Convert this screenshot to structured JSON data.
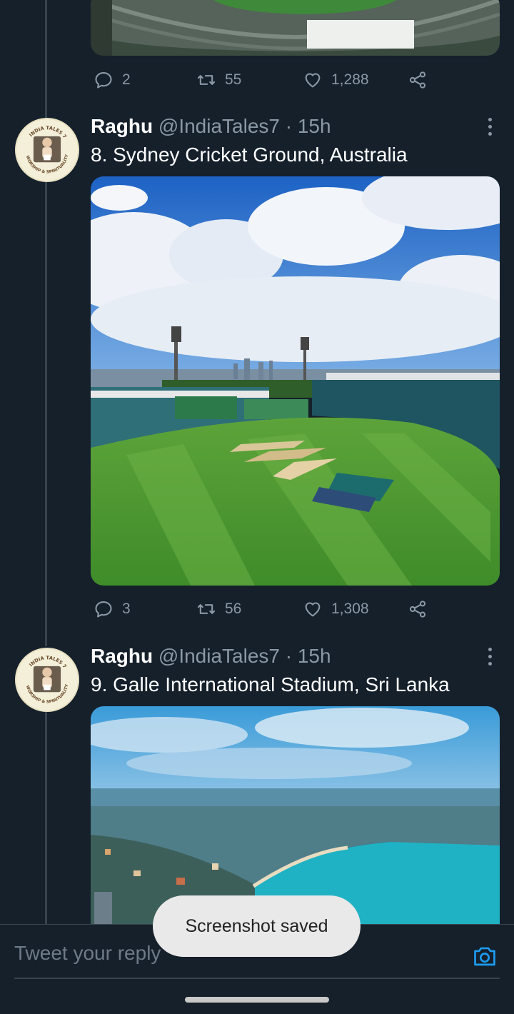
{
  "tweets": [
    {
      "stats": {
        "replies": "2",
        "retweets": "55",
        "likes": "1,288"
      }
    },
    {
      "author_name": "Raghu",
      "handle": "@IndiaTales7",
      "separator": "·",
      "time": "15h",
      "text": "8. Sydney Cricket Ground, Australia",
      "stats": {
        "replies": "3",
        "retweets": "56",
        "likes": "1,308"
      }
    },
    {
      "author_name": "Raghu",
      "handle": "@IndiaTales7",
      "separator": "·",
      "time": "15h",
      "text": "9. Galle International Stadium, Sri Lanka"
    }
  ],
  "avatar_text": {
    "top": "INDIA TALES 7",
    "bottom": "WORSHIP & SPIRITUALITY"
  },
  "reply": {
    "placeholder": "Tweet your reply"
  },
  "toast": {
    "message": "Screenshot saved"
  },
  "icons": {
    "reply": "reply-icon",
    "retweet": "retweet-icon",
    "like": "heart-icon",
    "share": "share-icon",
    "more": "more-icon",
    "camera": "camera-icon"
  },
  "colors": {
    "background": "#15202b",
    "muted": "#8b98a5",
    "accent": "#1d9bf0",
    "divider": "#38444d"
  }
}
